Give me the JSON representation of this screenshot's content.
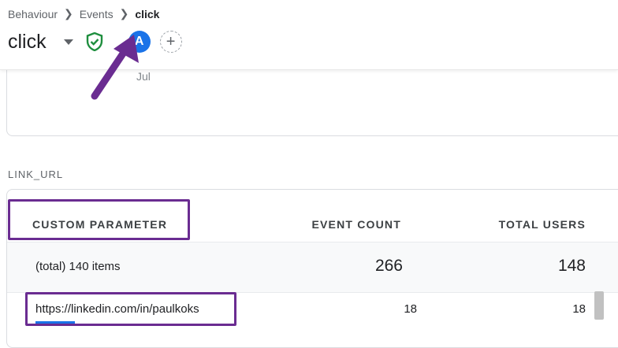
{
  "breadcrumb": {
    "items": [
      "Behaviour",
      "Events",
      "click"
    ]
  },
  "header": {
    "title": "click",
    "avatar_letter": "A",
    "add_label": "+"
  },
  "chart_card": {
    "axis_label": "Jul"
  },
  "section": {
    "label": "LINK_URL"
  },
  "table": {
    "columns": [
      "CUSTOM PARAMETER",
      "EVENT COUNT",
      "TOTAL USERS"
    ],
    "total_row": {
      "label": "(total) 140 items",
      "event_count": "266",
      "total_users": "148"
    },
    "rows": [
      {
        "label": "https://linkedin.com/in/paulkoks",
        "event_count": "18",
        "total_users": "18"
      }
    ]
  },
  "colors": {
    "accent": "#1a73e8",
    "annotation": "#6a2c91",
    "shield": "#1e8e3e"
  },
  "icons": {
    "caret": "chevron-down-icon",
    "shield": "shield-check-icon",
    "add": "plus-circle-icon"
  }
}
